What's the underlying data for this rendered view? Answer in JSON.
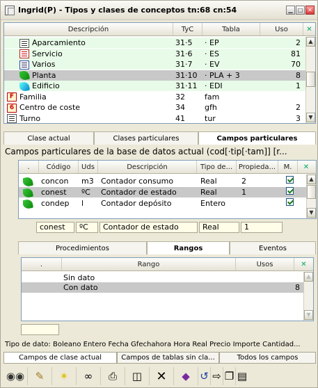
{
  "window": {
    "title": "Ingrid(P) - Tipos y clases de conceptos tn:68 cn:54"
  },
  "tree": {
    "headers": [
      "Descripción",
      "TyC",
      "Tabla",
      "Uso"
    ],
    "rows": [
      {
        "desc": "Aparcamiento",
        "tyc": "31·5",
        "tabla": "· EP",
        "uso": "2",
        "icon": "doc-icon",
        "indent": 2,
        "green": true
      },
      {
        "desc": "Servicio",
        "tyc": "31·6",
        "tabla": "· ES",
        "uso": "81",
        "icon": "doc-red-icon",
        "indent": 2,
        "green": true
      },
      {
        "desc": "Varios",
        "tyc": "31·7",
        "tabla": "· EV",
        "uso": "70",
        "icon": "doc-blue-icon",
        "indent": 2,
        "green": true
      },
      {
        "desc": "Planta",
        "tyc": "31·10",
        "tabla": "· PLA + 3",
        "uso": "8",
        "icon": "green-leaf-icon",
        "indent": 2,
        "selected": true
      },
      {
        "desc": "Edificio",
        "tyc": "31·11",
        "tabla": "· EDI",
        "uso": "1",
        "icon": "cyan-leaf-icon",
        "indent": 2,
        "green": true
      },
      {
        "desc": "Familia",
        "tyc": "32",
        "tabla": "fam",
        "uso": "",
        "icon": "f-icon",
        "indent": 1
      },
      {
        "desc": "Centro de coste",
        "tyc": "34",
        "tabla": "gfh",
        "uso": "2",
        "icon": "six-icon",
        "indent": 1
      },
      {
        "desc": "Turno",
        "tyc": "41",
        "tabla": "tur",
        "uso": "3",
        "icon": "doc-icon",
        "indent": 1
      }
    ]
  },
  "tabs1": [
    "Clase actual",
    "Clases particulares",
    "Campos particulares"
  ],
  "campos": {
    "caption": "Campos particulares de la base de datos actual (cod[·tip[·tam]] [r...",
    "headers": [
      ".",
      "Código",
      "Uds",
      "Descripción",
      "Tipo de...",
      "Propieda...",
      "M."
    ],
    "rows": [
      {
        "codigo": "concon",
        "uds": "m3",
        "desc": "Contador consumo",
        "tipo": "Real",
        "prop": "2",
        "m": true
      },
      {
        "codigo": "conest",
        "uds": "ºC",
        "desc": "Contador de estado",
        "tipo": "Real",
        "prop": "1",
        "m": true,
        "selected": true
      },
      {
        "codigo": "condep",
        "uds": "l",
        "desc": "Contador depósito",
        "tipo": "Entero",
        "prop": "",
        "m": true
      }
    ],
    "edit": {
      "codigo": "conest",
      "uds": "ºC",
      "desc": "Contador de estado",
      "tipo": "Real",
      "prop": "1"
    }
  },
  "tabs2": [
    "Procedimientos",
    "Rangos",
    "Eventos"
  ],
  "rangos": {
    "headers": [
      ".",
      "Rango",
      "Usos"
    ],
    "rows": [
      {
        "rango": "Sin dato",
        "usos": ""
      },
      {
        "rango": "Con dato",
        "usos": "8",
        "selected": true
      }
    ]
  },
  "status": "Tipo de dato: Boleano Entero Fecha Gfechahora Hora Real Precio Importe Cantidad...",
  "bottomTabs": [
    "Campos de clase actual",
    "Campos de tablas sin cla...",
    "Todos los campos"
  ],
  "toolbar": [
    "binoculars-icon",
    "notepad-icon",
    "star-icon",
    "link-icon",
    "printer-icon",
    "network-icon",
    "delete-icon",
    "eraser-icon",
    "refresh-icon",
    "export-icon",
    "copy-icon",
    "paste-icon"
  ]
}
